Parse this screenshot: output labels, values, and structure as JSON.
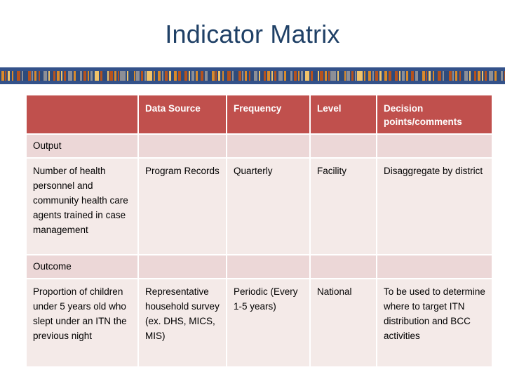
{
  "slide": {
    "title": "Indicator Matrix"
  },
  "decor": {
    "band_name": "decorative-pattern-band",
    "base_color": "#2e4b7c",
    "accent_colors": [
      "#d98a2b",
      "#b5521e",
      "#8d8f96",
      "#f0c36a"
    ]
  },
  "table": {
    "headers": [
      "",
      "Data Source",
      "Frequency",
      "Level",
      "Decision points/comments"
    ],
    "header_bg": "#c0504d",
    "section_bg": "#ecd7d7",
    "cell_bg": "#f4eae8",
    "sections": [
      {
        "label": "Output",
        "rows": [
          {
            "indicator": "Number of health personnel and community health care agents trained in case management",
            "data_source": "Program Records",
            "frequency": "Quarterly",
            "level": "Facility",
            "decision_points": "Disaggregate by district"
          }
        ]
      },
      {
        "label": "Outcome",
        "rows": [
          {
            "indicator": "Proportion of children under 5 years old who slept under an ITN the previous night",
            "data_source": "Representative household survey (ex. DHS, MICS, MIS)",
            "frequency": "Periodic (Every 1-5 years)",
            "level": "National",
            "decision_points": "To be used to determine where to target ITN distribution and BCC activities"
          }
        ]
      }
    ]
  }
}
